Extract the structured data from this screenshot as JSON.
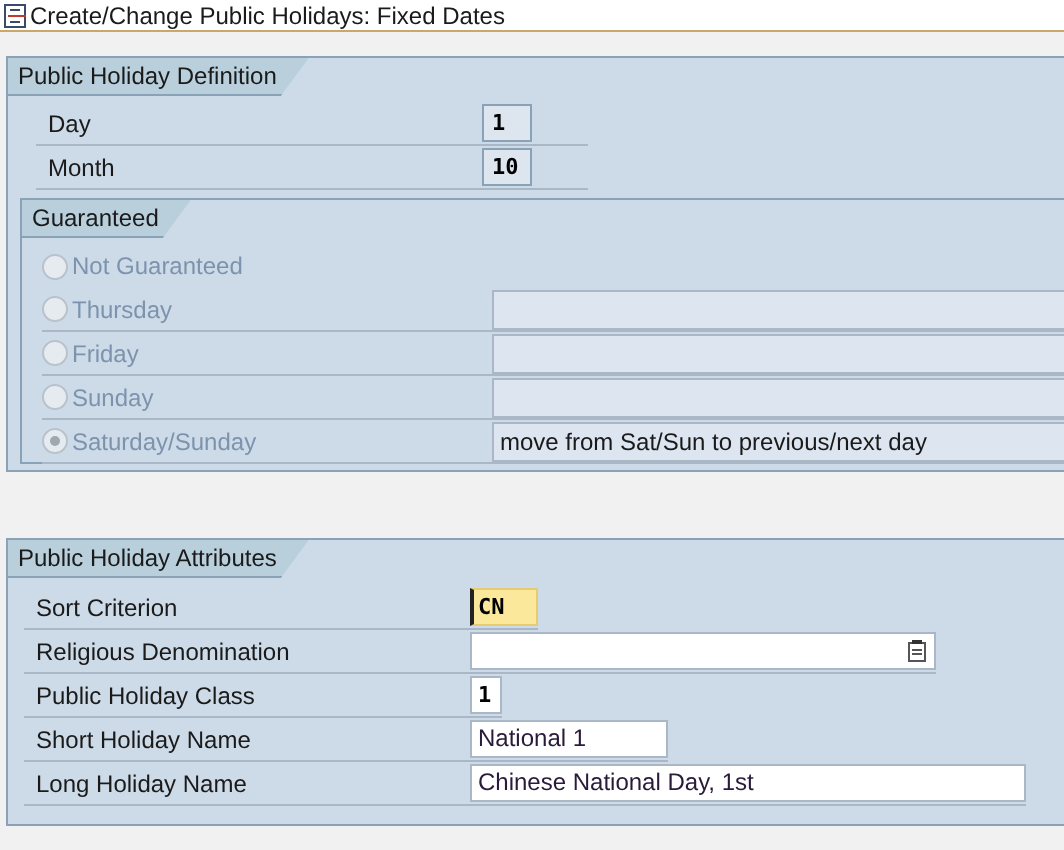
{
  "window": {
    "title": "Create/Change Public Holidays: Fixed Dates"
  },
  "definition": {
    "title": "Public Holiday Definition",
    "fields": [
      {
        "label": "Day",
        "value": "1"
      },
      {
        "label": "Month",
        "value": "10"
      }
    ],
    "guaranteed": {
      "title": "Guaranteed",
      "options": [
        {
          "label": "Not Guaranteed",
          "selected": false,
          "kind": "plain"
        },
        {
          "label": "Thursday",
          "selected": false,
          "kind": "text"
        },
        {
          "label": "Friday",
          "selected": false,
          "kind": "text"
        },
        {
          "label": "Sunday",
          "selected": false,
          "kind": "text"
        },
        {
          "label": "Saturday/Sunday",
          "selected": true,
          "kind": "text",
          "value": "move from Sat/Sun to previous/next day"
        }
      ]
    }
  },
  "attributes": {
    "title": "Public Holiday Attributes",
    "fields": [
      {
        "label": "Sort Criterion",
        "value": "CN",
        "kind": "required"
      },
      {
        "label": "Religious Denomination",
        "kind": "dropdown"
      },
      {
        "label": "Public Holiday Class",
        "value": "1",
        "kind": "tiny"
      },
      {
        "label": "Short Holiday Name",
        "value": "National 1",
        "kind": "short"
      },
      {
        "label": "Long Holiday Name",
        "value": "Chinese National Day, 1st",
        "kind": "long"
      }
    ]
  }
}
